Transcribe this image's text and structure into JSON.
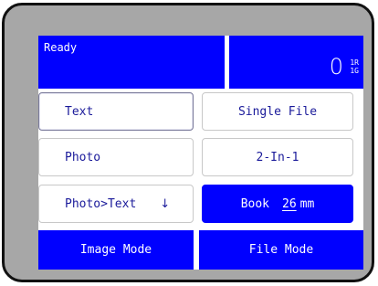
{
  "status": {
    "text": "Ready"
  },
  "counter": {
    "value": "0",
    "sub_top": "1R",
    "sub_bottom": "1G"
  },
  "image_options": [
    {
      "label": "Text"
    },
    {
      "label": "Photo"
    },
    {
      "label": "Photo>Text",
      "icon": "down-arrow-icon"
    }
  ],
  "file_options": [
    {
      "label": "Single File"
    },
    {
      "label": "2-In-1"
    },
    {
      "label": "Book",
      "value": "26",
      "unit": "mm"
    }
  ],
  "modes": {
    "image_mode": "Image Mode",
    "file_mode": "File Mode"
  },
  "colors": {
    "accent": "#0000ff",
    "frame": "#a7a7a7",
    "text": "#1a1a9a"
  }
}
